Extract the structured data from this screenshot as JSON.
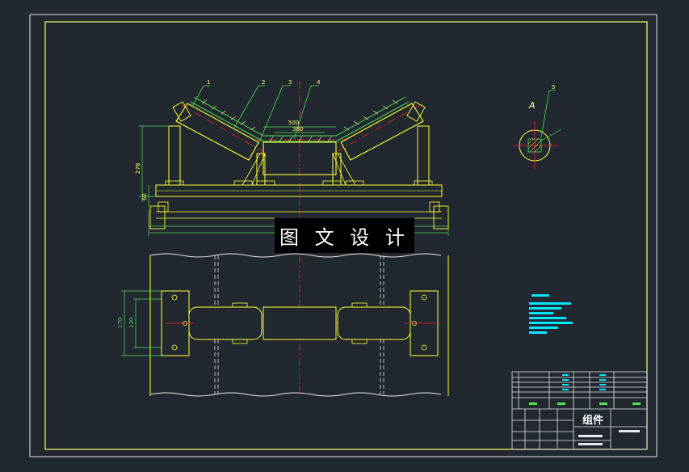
{
  "watermark": "图 文 设 计",
  "title_block": {
    "name": "组件"
  },
  "section_label": "A",
  "dimensions": {
    "top_width": "500",
    "inner_width": "380",
    "height_left": "278",
    "base_left": "62",
    "plan_outer": "170",
    "plan_inner": "130"
  },
  "colors": {
    "background": "#212830",
    "frame": "#ffff66",
    "part_lines": "#ffff33",
    "dimension_lines": "#4fdf4f",
    "center_lines": "#ff2020",
    "hidden_lines": "#e0e0e0",
    "notes": "#00e5ff"
  }
}
